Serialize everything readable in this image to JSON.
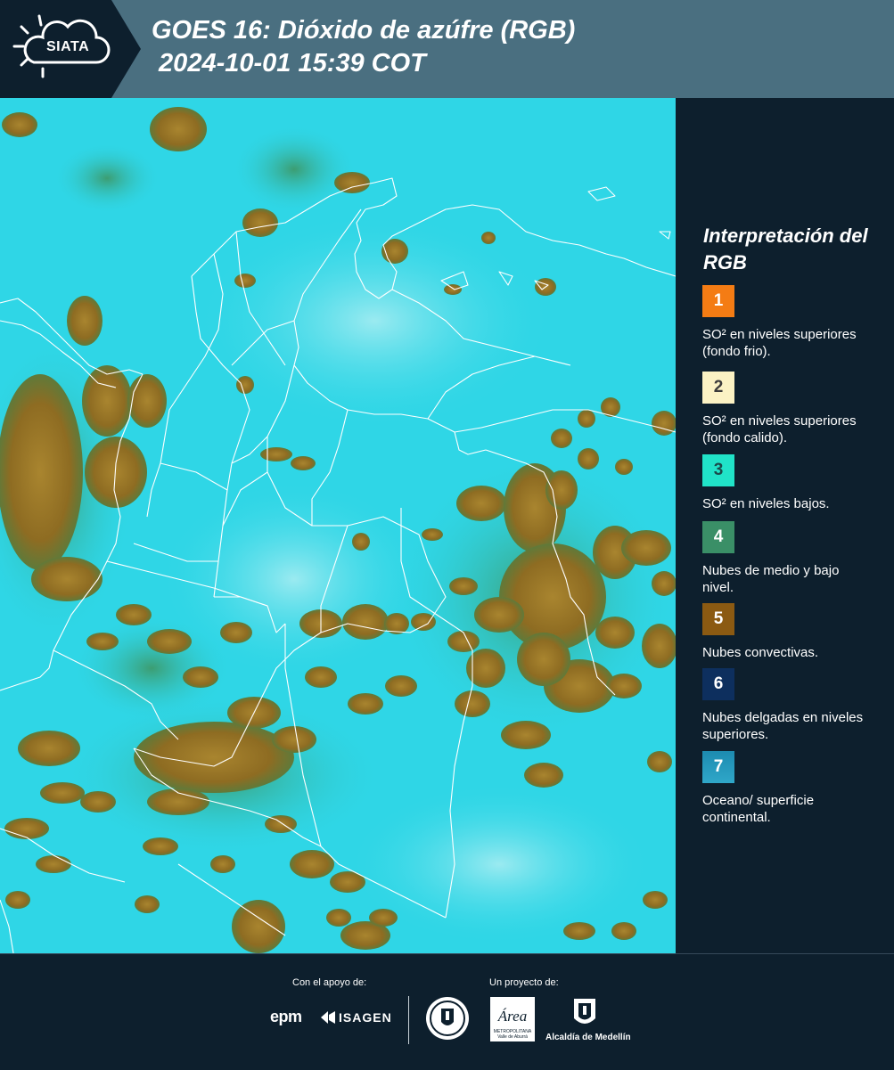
{
  "header": {
    "logo_text": "SIATA",
    "title": "GOES 16: Dióxido de azúfre (RGB)\n 2024-10-01 15:39 COT"
  },
  "map": {
    "description_icon": "satellite-map",
    "background_color": "#2fd6e6",
    "cloud_color": "#9c7a2a",
    "border_color": "#ffffff"
  },
  "legend": {
    "title": "Interpretación del RGB",
    "items": [
      {
        "number": "1",
        "color": "#f47c14",
        "text": "SO² en niveles superiores (fondo frio)."
      },
      {
        "number": "2",
        "color": "#fbf2c4",
        "text": "SO² en niveles superiores (fondo calido)."
      },
      {
        "number": "3",
        "color": "#20e3c8",
        "text": "SO² en niveles bajos."
      },
      {
        "number": "4",
        "color": "#3a8f67",
        "text": "Nubes de medio y bajo nivel."
      },
      {
        "number": "5",
        "color": "#8b5a12",
        "text": "Nubes convectivas."
      },
      {
        "number": "6",
        "color": "#0d2f5e",
        "text": "Nubes delgadas en niveles superiores."
      },
      {
        "number": "7",
        "color": "#1d8bb0",
        "text": "Oceano/ superficie continental."
      }
    ]
  },
  "footer": {
    "support_label": "Con el apoyo de:",
    "project_label": "Un proyecto de:",
    "epm": "epm",
    "isagen": "ISAGEN",
    "area_name": "Área",
    "area_sub": "METROPOLITANA",
    "area_sub2": "Valle de Aburrá",
    "alcaldia": "Alcaldía de Medellín"
  }
}
